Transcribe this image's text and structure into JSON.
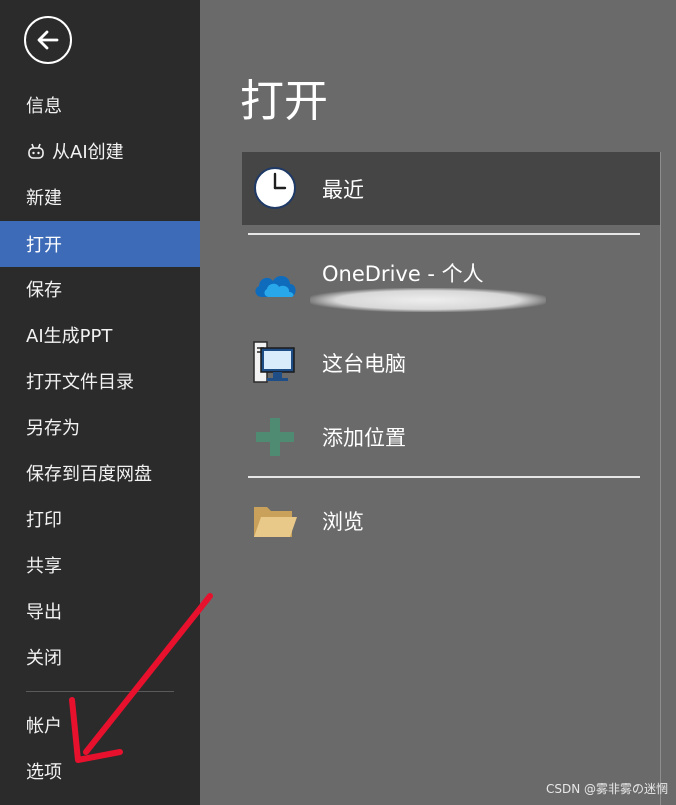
{
  "sidebar": {
    "items": [
      {
        "label": "信息"
      },
      {
        "label": "从AI创建"
      },
      {
        "label": "新建"
      },
      {
        "label": "打开"
      },
      {
        "label": "保存"
      },
      {
        "label": "AI生成PPT"
      },
      {
        "label": "打开文件目录"
      },
      {
        "label": "另存为"
      },
      {
        "label": "保存到百度网盘"
      },
      {
        "label": "打印"
      },
      {
        "label": "共享"
      },
      {
        "label": "导出"
      },
      {
        "label": "关闭"
      },
      {
        "label": "帐户"
      },
      {
        "label": "选项"
      }
    ],
    "active_item": "打开"
  },
  "main": {
    "title": "打开",
    "locations": [
      {
        "label": "最近",
        "icon": "clock-icon",
        "selected": true
      },
      {
        "label": "OneDrive - 个人",
        "icon": "onedrive-cloud-icon",
        "selected": false
      },
      {
        "label": "这台电脑",
        "icon": "computer-icon",
        "selected": false
      },
      {
        "label": "添加位置",
        "icon": "plus-icon",
        "selected": false
      },
      {
        "label": "浏览",
        "icon": "folder-icon",
        "selected": false
      }
    ]
  },
  "colors": {
    "sidebar_bg": "#2b2b2b",
    "main_bg": "#6a6a6a",
    "active_blue": "#3e6bb8",
    "selected_row": "#454545",
    "annotation_arrow": "#e8112d"
  },
  "watermark": "CSDN @雾非雾の迷惘"
}
